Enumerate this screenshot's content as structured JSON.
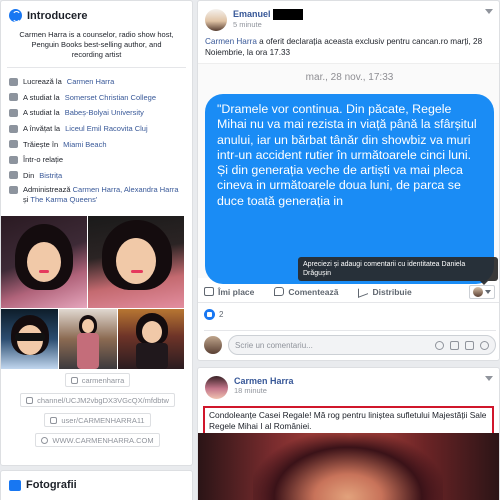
{
  "intro": {
    "title": "Introducere",
    "icon": "globe-icon",
    "bio": "Carmen Harra is a counselor, radio show host, Penguin Books best-selling author, and recording artist",
    "facts": [
      {
        "pre": "Lucrează la ",
        "link": "Carmen Harra",
        "icon": "briefcase-icon"
      },
      {
        "pre": "A studiat la ",
        "link": "Somerset Christian College",
        "icon": "graduation-cap-icon"
      },
      {
        "pre": "A studiat la ",
        "link": "Babeș-Bolyai University",
        "icon": "graduation-cap-icon"
      },
      {
        "pre": "A învățat la ",
        "link": "Liceul Emil Racovita Cluj",
        "icon": "graduation-cap-icon"
      },
      {
        "pre": "Trăiește în ",
        "link": "Miami Beach",
        "icon": "home-icon"
      },
      {
        "pre": "Într-o relație",
        "link": "",
        "icon": "heart-icon"
      },
      {
        "pre": "Din ",
        "link": "Bistrița",
        "icon": "location-pin-icon"
      }
    ],
    "admin": {
      "pre": "Administrează ",
      "link1": "Carmen Harra, Alexandra Harra",
      "mid": " și ",
      "link2": "The Karma Queens'"
    },
    "links": [
      {
        "text": "carmenharra",
        "icon": "instagram-icon"
      },
      {
        "text": "channel/UCJM2vbgDX3VGcQX/mfdbtw",
        "icon": "youtube-icon"
      },
      {
        "text": "user/CARMENHARRA11",
        "icon": "youtube-icon"
      },
      {
        "text": "WWW.CARMENHARRA.COM",
        "icon": "globe-icon"
      }
    ]
  },
  "photos_section": {
    "title": "Fotografii",
    "icon": "photo-icon"
  },
  "post1": {
    "author": "Emanuel",
    "time": "5 minute",
    "text_link": "Carmen Harra",
    "text": " a oferit declarația aceasta exclusiv pentru cancan.ro marți, 28 Noiembrie, la ora 17.33",
    "stamp": "mar., 28 nov., 17:33",
    "bubble": "\"Dramele vor continua. Din păcate, Regele Mihai nu va mai rezista in viață până la sfârșitul anului, iar un bărbat tânăr din showbiz va muri intr-un accident rutier în următoarele cinci luni. Și din generația veche de artiști va mai pleca cineva in următoarele doua luni, de parca se duce toată generația in",
    "tooltip": "Apreciezi și adaugi comentarii cu identitatea Daniela Drăgușin",
    "actions": {
      "like": "Îmi place",
      "comment": "Comentează",
      "share": "Distribuie"
    },
    "like_count": "2",
    "comment_placeholder": "Scrie un comentariu..."
  },
  "post2": {
    "author": "Carmen Harra",
    "time": "18 minute",
    "text": "Condoleanțe Casei Regale! Mă rog pentru liniștea sufletului Majestății Sale Regele Mihai I al României."
  },
  "colors": {
    "link": "#385898",
    "accent": "#1877f2",
    "bubble": "#1a8cf5",
    "highlight_border": "#d0162b"
  }
}
